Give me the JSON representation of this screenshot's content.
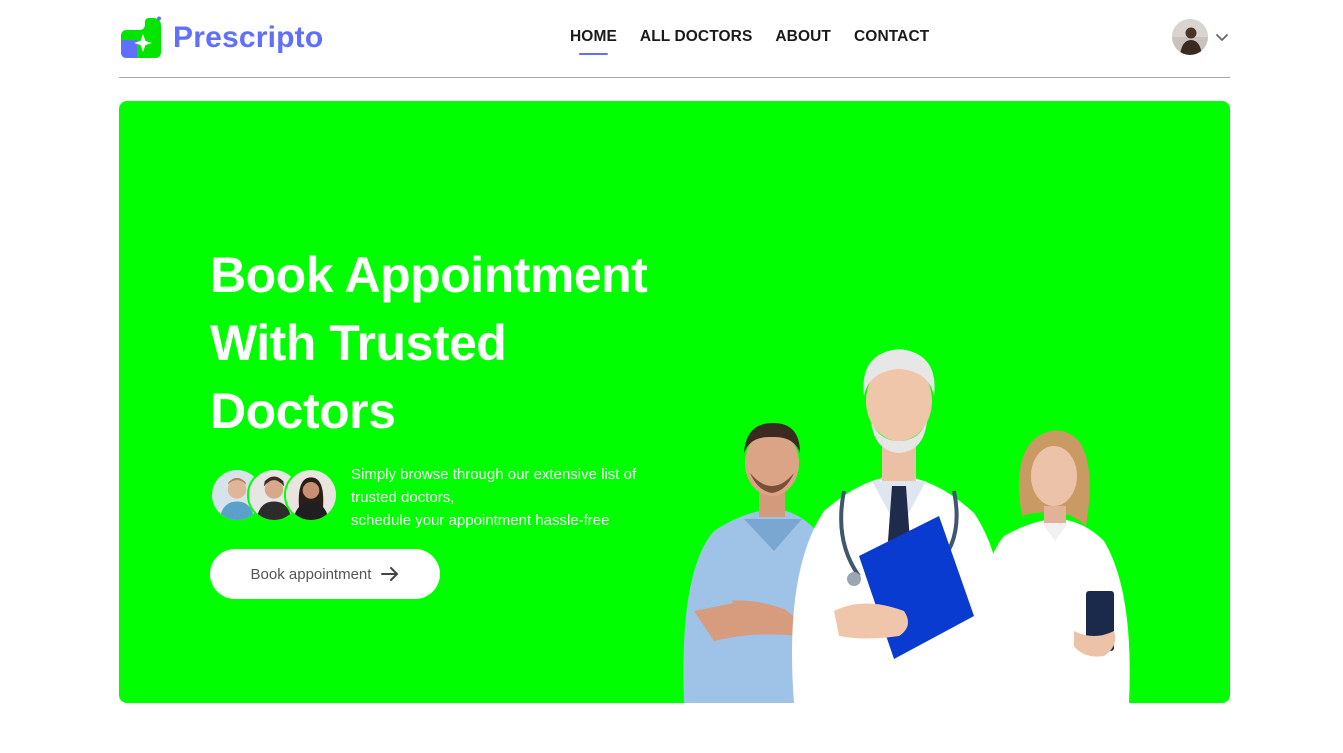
{
  "brand": {
    "name": "Prescripto",
    "color": "#5f6fff"
  },
  "nav": {
    "items": [
      {
        "label": "HOME",
        "active": true
      },
      {
        "label": "ALL DOCTORS",
        "active": false
      },
      {
        "label": "ABOUT",
        "active": false
      },
      {
        "label": "CONTACT",
        "active": false
      }
    ]
  },
  "profile": {
    "avatar_icon": "user-avatar",
    "dropdown_icon": "chevron-down-icon"
  },
  "hero": {
    "background": "#00ff00",
    "title_lines": [
      "Book Appointment",
      "With Trusted",
      "Doctors"
    ],
    "description_lines": [
      "Simply browse through our extensive list of",
      "trusted doctors,",
      "schedule your appointment hassle-free"
    ],
    "cta_label": "Book appointment",
    "cta_icon": "arrow-right-icon"
  }
}
